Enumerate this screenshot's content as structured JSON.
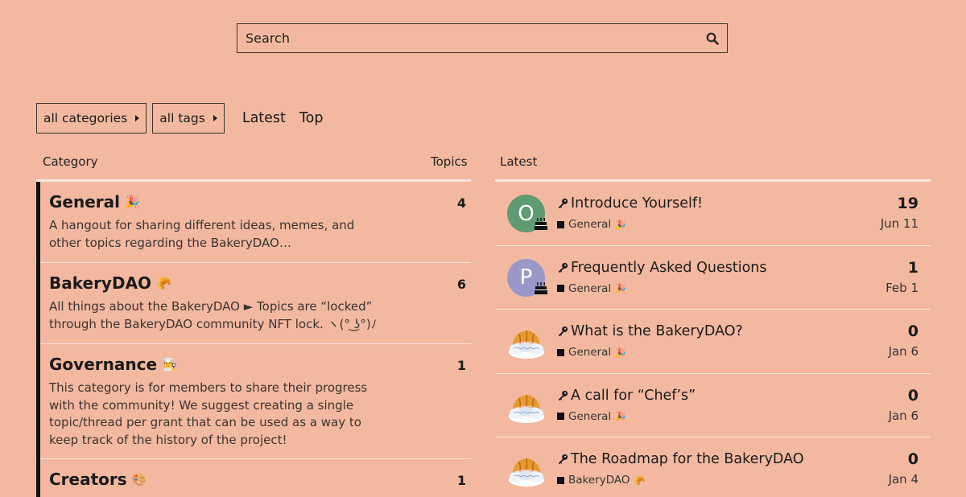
{
  "search": {
    "placeholder": "Search"
  },
  "nav": {
    "categories_label": "all categories",
    "tags_label": "all tags",
    "latest_label": "Latest",
    "top_label": "Top"
  },
  "headers": {
    "category": "Category",
    "topics": "Topics",
    "latest": "Latest"
  },
  "categories": [
    {
      "name": "General",
      "icon": "party-popper-icon",
      "description": "A hangout for sharing different ideas, memes, and other topics regarding the BakeryDAO…",
      "topics": "4"
    },
    {
      "name": "BakeryDAO",
      "icon": "croissant-icon",
      "description": "All things about the BakeryDAO ► Topics are “locked” through the BakeryDAO community NFT lock. ヽ(° ͜ʖ°)ﾉ",
      "topics": "6"
    },
    {
      "name": "Governance",
      "icon": "cook-icon",
      "description": "This category is for members to share their progress with the community! We suggest creating a single topic/thread per grant that can be used as a way to keep track of the history of the project!",
      "topics": "1"
    },
    {
      "name": "Creators",
      "icon": "palette-icon",
      "description": "",
      "topics": "1"
    }
  ],
  "latest_topics": [
    {
      "avatar_letter": "O",
      "avatar_color": "#5e9a72",
      "title": "Introduce Yourself!",
      "category": "General",
      "replies": "19",
      "date": "Jun 11"
    },
    {
      "avatar_letter": "P",
      "avatar_color": "#9a98c8",
      "title": "Frequently Asked Questions",
      "category": "General",
      "replies": "1",
      "date": "Feb 1"
    },
    {
      "avatar_letter": "",
      "avatar_color": "",
      "title": "What is the BakeryDAO?",
      "category": "General",
      "replies": "0",
      "date": "Jan 6"
    },
    {
      "avatar_letter": "",
      "avatar_color": "",
      "title": "A call for “Chef’s”",
      "category": "General",
      "replies": "0",
      "date": "Jan 6"
    },
    {
      "avatar_letter": "",
      "avatar_color": "",
      "title": "The Roadmap for the BakeryDAO",
      "category": "BakeryDAO",
      "replies": "0",
      "date": "Jan 4"
    }
  ]
}
